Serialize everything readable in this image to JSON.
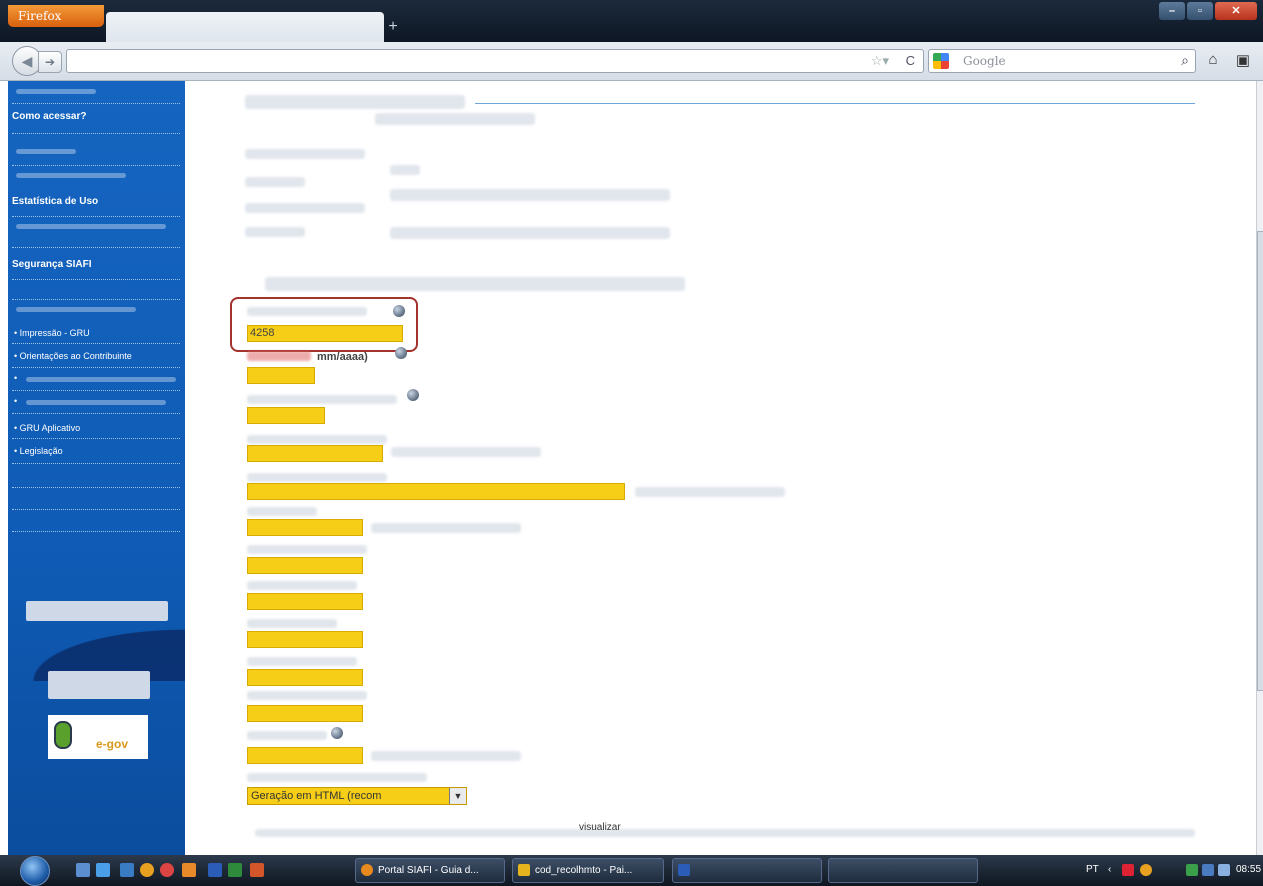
{
  "browser": {
    "menu_button": "Firefox",
    "search_placeholder": "Google",
    "new_tab": "+"
  },
  "sidebar": {
    "headings": [
      "Como acessar?",
      "Estatística de Uso",
      "Segurança SIAFI"
    ],
    "links": [
      "Impressão - GRU",
      "Orientações ao Contribuinte",
      "GRU Aplicativo",
      "Legislação"
    ],
    "egov_logo_text": "e-gov"
  },
  "form": {
    "first_field_value": "4258",
    "date_hint": "mm/aaaa)",
    "output_select": "Geração em HTML (recom",
    "visualizar": "visualizar"
  },
  "taskbar": {
    "tasks": [
      "Portal SIAFI - Guia d...",
      "cod_recolhmto - Pai...",
      ""
    ],
    "language": "PT",
    "clock": "08:55"
  },
  "colors": {
    "sidebar_blue": "#1565c0",
    "field_yellow": "#f6ce17",
    "highlight_red": "#a3332c",
    "firefox_orange": "#e6780f"
  }
}
